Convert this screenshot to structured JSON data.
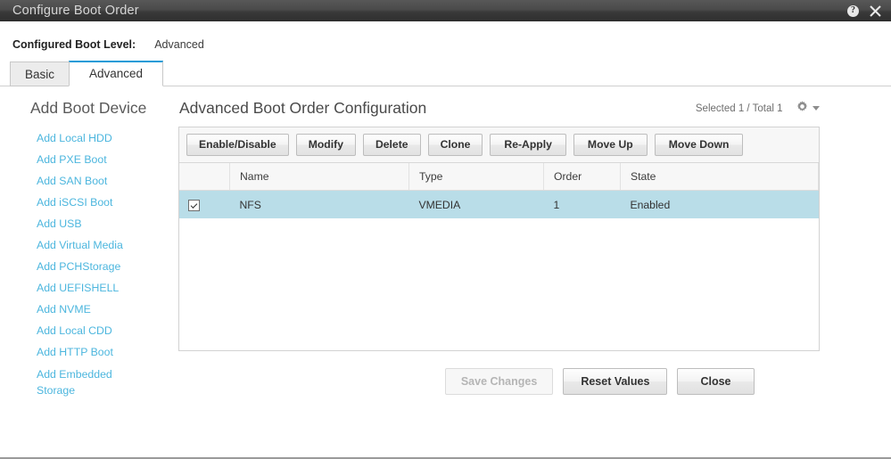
{
  "titlebar": {
    "title": "Configure Boot Order",
    "help_icon": "help-circle-icon",
    "help_glyph": "?",
    "close_icon": "close-icon",
    "close_glyph": "✕"
  },
  "boot_level": {
    "label": "Configured Boot Level:",
    "value": "Advanced"
  },
  "tabs": [
    {
      "label": "Basic",
      "active": false
    },
    {
      "label": "Advanced",
      "active": true
    }
  ],
  "sidebar": {
    "title": "Add Boot Device",
    "items": [
      {
        "label": "Add Local HDD"
      },
      {
        "label": "Add PXE Boot"
      },
      {
        "label": "Add SAN Boot"
      },
      {
        "label": "Add iSCSI Boot"
      },
      {
        "label": "Add USB"
      },
      {
        "label": "Add Virtual Media"
      },
      {
        "label": "Add PCHStorage"
      },
      {
        "label": "Add UEFISHELL"
      },
      {
        "label": "Add NVME"
      },
      {
        "label": "Add Local CDD"
      },
      {
        "label": "Add HTTP Boot"
      },
      {
        "label": "Add Embedded Storage"
      }
    ]
  },
  "panel": {
    "title": "Advanced Boot Order Configuration",
    "count_text": "Selected 1 / Total 1",
    "settings_icon": "gear-icon",
    "settings_caret_icon": "chevron-down-icon",
    "toolbar": [
      {
        "label": "Enable/Disable"
      },
      {
        "label": "Modify"
      },
      {
        "label": "Delete"
      },
      {
        "label": "Clone"
      },
      {
        "label": "Re-Apply"
      },
      {
        "label": "Move Up"
      },
      {
        "label": "Move Down"
      }
    ],
    "table": {
      "columns": [
        "",
        "Name",
        "Type",
        "Order",
        "State",
        ""
      ],
      "rows": [
        {
          "checked": true,
          "name": "NFS",
          "type": "VMEDIA",
          "order": "1",
          "state": "Enabled",
          "selected": true
        }
      ]
    }
  },
  "footer": {
    "save_label": "Save Changes",
    "save_disabled": true,
    "reset_label": "Reset Values",
    "close_label": "Close"
  },
  "colors": {
    "titlebar_dark": "#3a3a3a",
    "link_blue": "#4cb6de",
    "tab_accent": "#1a9bd7",
    "row_selected": "#b9dde8",
    "header_bg": "#f7f7f7"
  }
}
